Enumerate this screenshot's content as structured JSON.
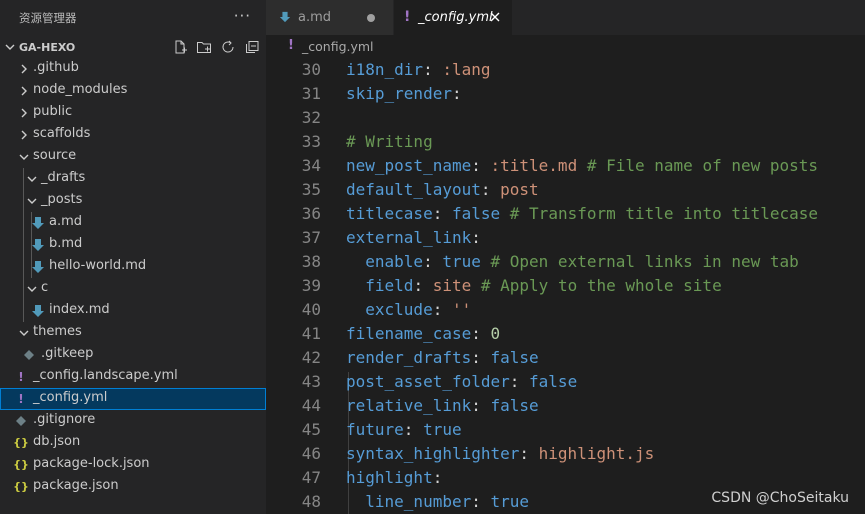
{
  "sidebar": {
    "title": "资源管理器",
    "more": "···",
    "project": "GA-HEXO",
    "items": [
      {
        "label": ".github",
        "icon": "chevron-right-icon"
      },
      {
        "label": "node_modules",
        "icon": "chevron-right-icon"
      },
      {
        "label": "public",
        "icon": "chevron-right-icon"
      },
      {
        "label": "scaffolds",
        "icon": "chevron-right-icon"
      },
      {
        "label": "source",
        "icon": "chevron-down-icon"
      },
      {
        "label": "_drafts",
        "icon": "chevron-down-icon"
      },
      {
        "label": "_posts",
        "icon": "chevron-down-icon"
      },
      {
        "label": "a.md",
        "icon": "markdown-icon"
      },
      {
        "label": "b.md",
        "icon": "markdown-icon"
      },
      {
        "label": "hello-world.md",
        "icon": "markdown-icon"
      },
      {
        "label": "c",
        "icon": "chevron-down-icon"
      },
      {
        "label": "index.md",
        "icon": "markdown-icon"
      },
      {
        "label": "themes",
        "icon": "chevron-down-icon"
      },
      {
        "label": ".gitkeep",
        "icon": "diamond-icon"
      },
      {
        "label": "_config.landscape.yml",
        "icon": "yaml-icon"
      },
      {
        "label": "_config.yml",
        "icon": "yaml-icon",
        "selected": true
      },
      {
        "label": ".gitignore",
        "icon": "diamond-icon"
      },
      {
        "label": "db.json",
        "icon": "json-icon"
      },
      {
        "label": "package-lock.json",
        "icon": "json-icon"
      },
      {
        "label": "package.json",
        "icon": "json-icon"
      }
    ]
  },
  "tabs": [
    {
      "label": "a.md",
      "icon": "markdown-icon",
      "modified": true
    },
    {
      "label": "_config.yml",
      "icon": "yaml-icon",
      "active": true
    }
  ],
  "breadcrumb": "_config.yml",
  "editor": {
    "lines": [
      {
        "n": "30",
        "toks": [
          [
            "k",
            "i18n_dir"
          ],
          [
            "p",
            ": "
          ],
          [
            "s",
            ":lang"
          ]
        ]
      },
      {
        "n": "31",
        "toks": [
          [
            "k",
            "skip_render"
          ],
          [
            "p",
            ":"
          ]
        ]
      },
      {
        "n": "32",
        "toks": []
      },
      {
        "n": "33",
        "toks": [
          [
            "c",
            "# Writing"
          ]
        ]
      },
      {
        "n": "34",
        "toks": [
          [
            "k",
            "new_post_name"
          ],
          [
            "p",
            ": "
          ],
          [
            "s",
            ":title.md"
          ],
          [
            "p",
            " "
          ],
          [
            "c",
            "# File name of new posts"
          ]
        ]
      },
      {
        "n": "35",
        "toks": [
          [
            "k",
            "default_layout"
          ],
          [
            "p",
            ": "
          ],
          [
            "s",
            "post"
          ]
        ]
      },
      {
        "n": "36",
        "toks": [
          [
            "k",
            "titlecase"
          ],
          [
            "p",
            ": "
          ],
          [
            "k",
            "false"
          ],
          [
            "p",
            " "
          ],
          [
            "c",
            "# Transform title into titlecase"
          ]
        ]
      },
      {
        "n": "37",
        "toks": [
          [
            "k",
            "external_link"
          ],
          [
            "p",
            ":"
          ]
        ]
      },
      {
        "n": "38",
        "toks": [
          [
            "p",
            "  "
          ],
          [
            "k",
            "enable"
          ],
          [
            "p",
            ": "
          ],
          [
            "k",
            "true"
          ],
          [
            "p",
            " "
          ],
          [
            "c",
            "# Open external links in new tab"
          ]
        ]
      },
      {
        "n": "39",
        "toks": [
          [
            "p",
            "  "
          ],
          [
            "k",
            "field"
          ],
          [
            "p",
            ": "
          ],
          [
            "s",
            "site"
          ],
          [
            "p",
            " "
          ],
          [
            "c",
            "# Apply to the whole site"
          ]
        ]
      },
      {
        "n": "40",
        "toks": [
          [
            "p",
            "  "
          ],
          [
            "k",
            "exclude"
          ],
          [
            "p",
            ": "
          ],
          [
            "s",
            "''"
          ]
        ]
      },
      {
        "n": "41",
        "toks": [
          [
            "k",
            "filename_case"
          ],
          [
            "p",
            ": "
          ],
          [
            "n",
            "0"
          ]
        ]
      },
      {
        "n": "42",
        "toks": [
          [
            "k",
            "render_drafts"
          ],
          [
            "p",
            ": "
          ],
          [
            "k",
            "false"
          ]
        ]
      },
      {
        "n": "43",
        "toks": [
          [
            "k",
            "post_asset_folder"
          ],
          [
            "p",
            ": "
          ],
          [
            "k",
            "false"
          ]
        ]
      },
      {
        "n": "44",
        "toks": [
          [
            "k",
            "relative_link"
          ],
          [
            "p",
            ": "
          ],
          [
            "k",
            "false"
          ]
        ]
      },
      {
        "n": "45",
        "toks": [
          [
            "k",
            "future"
          ],
          [
            "p",
            ": "
          ],
          [
            "k",
            "true"
          ]
        ]
      },
      {
        "n": "46",
        "toks": [
          [
            "k",
            "syntax_highlighter"
          ],
          [
            "p",
            ": "
          ],
          [
            "s",
            "highlight.js"
          ]
        ]
      },
      {
        "n": "47",
        "toks": [
          [
            "k",
            "highlight"
          ],
          [
            "p",
            ":"
          ]
        ]
      },
      {
        "n": "48",
        "toks": [
          [
            "p",
            "  "
          ],
          [
            "k",
            "line_number"
          ],
          [
            "p",
            ": "
          ],
          [
            "k",
            "true"
          ]
        ]
      }
    ]
  },
  "watermark": "CSDN @ChoSeitaku",
  "colors": {
    "keyword": "#569cd6",
    "string": "#ce9178",
    "comment": "#6a9955",
    "number": "#b5cea8",
    "accent": "#007fd4"
  }
}
